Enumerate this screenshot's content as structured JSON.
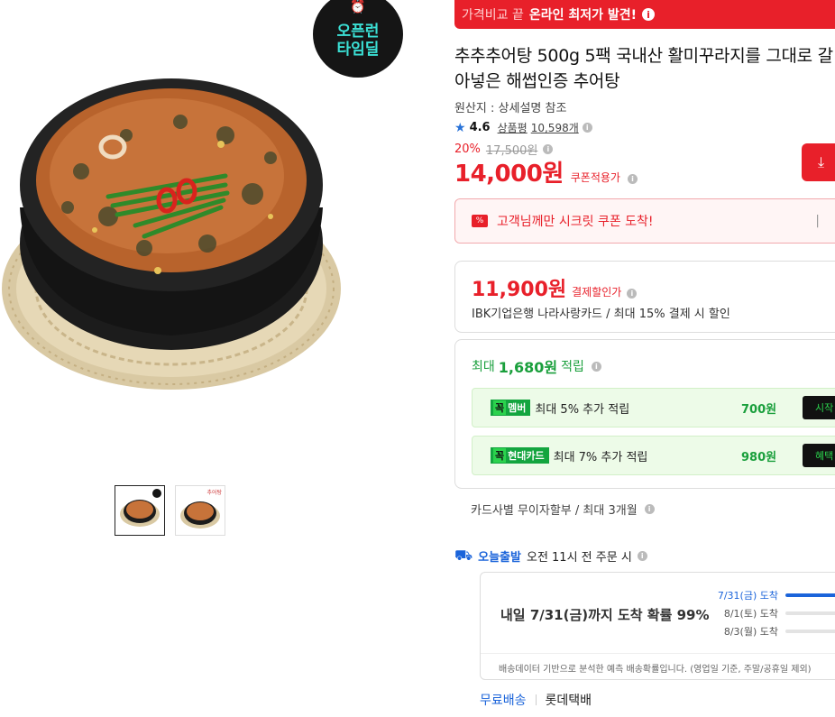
{
  "promo": {
    "prefix": "가격비교 끝",
    "highlight": "온라인 최저가 발견!",
    "info_icon": "info-icon"
  },
  "product": {
    "badge_line1": "오픈런",
    "badge_line2": "타임딜",
    "title": "추추추어탕 500g 5팩 국내산 활미꾸라지를 그대로 갈아넣은 해썹인증 추어탕",
    "origin": "원산지 : 상세설명 참조",
    "rating": "4.6",
    "review_label": "상품평",
    "review_count": "10,598개",
    "discount_rate": "20%",
    "original_price": "17,500원",
    "final_price": "14,000원",
    "coupon_label": "쿠폰적용가",
    "thumb_badge": "추어탕"
  },
  "secret_coupon": {
    "text": "고객님께만 시크릿 쿠폰 도착!",
    "icon_label": "%"
  },
  "card_discount": {
    "price": "11,900원",
    "label": "결제할인가",
    "desc": "IBK기업은행 나라사랑카드 / 최대 15% 결제 시 할인"
  },
  "reward": {
    "prefix": "최대",
    "amount": "1,680원",
    "suffix": "적립",
    "items": [
      {
        "badge_a": "꼭",
        "badge_b": "멤버",
        "text": "최대 5% 추가 적립",
        "amount": "700원",
        "button": "시작"
      },
      {
        "badge_a": "꼭",
        "badge_b": "현대카드",
        "text": "최대 7% 추가 적립",
        "amount": "980원",
        "button": "혜택"
      }
    ]
  },
  "installment": "카드사별 무이자할부 / 최대 3개월",
  "delivery": {
    "today_label": "오늘출발",
    "note": "오전 11시 전 주문 시",
    "forecast_main": "내일 7/31(금)까지 도착 확률 99%",
    "forecast": [
      {
        "label": "7/31(금) 도착",
        "fill": 0.99
      },
      {
        "label": "8/1(토) 도착",
        "fill": 0.0
      },
      {
        "label": "8/3(월) 도착",
        "fill": 0.0
      }
    ],
    "footnote": "배송데이터 기반으로 분석한 예측 배송확률입니다. (영업일 기준, 주말/공휴일 제외)",
    "free_shipping": "무료배송",
    "carrier": "롯데택배"
  },
  "colors": {
    "accent": "#e8202a",
    "reward_green": "#1a9f3c",
    "delivery_blue": "#1b64da"
  }
}
